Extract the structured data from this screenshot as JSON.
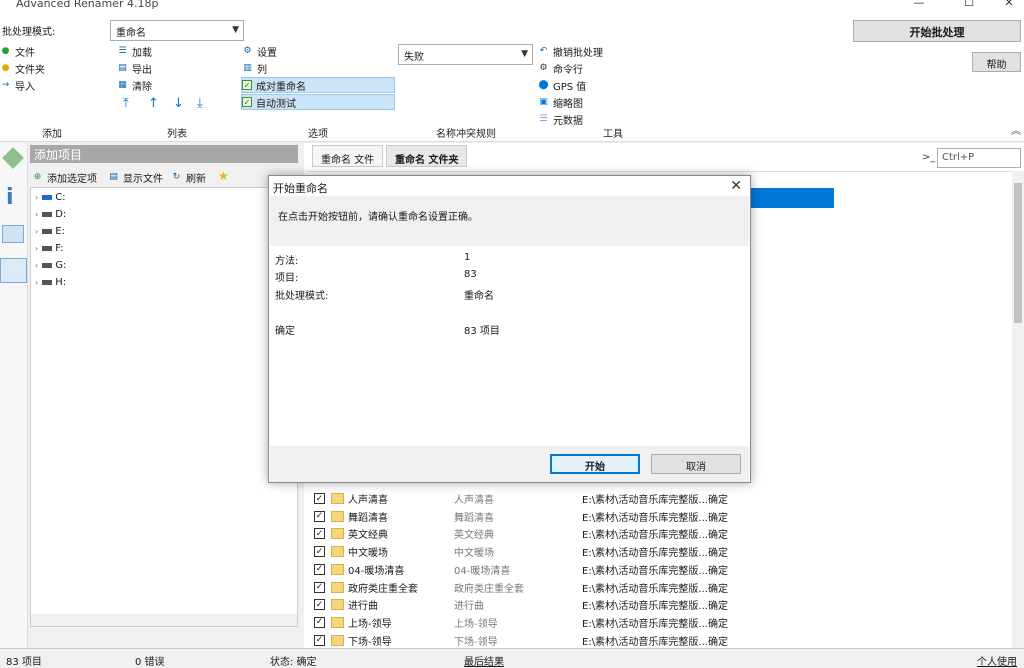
{
  "window": {
    "title": "Advanced Renamer 4.18p",
    "minimize": "—",
    "maximize": "☐",
    "close": "✕"
  },
  "ribbon": {
    "batch_mode_label": "批处理模式:",
    "batch_mode_value": "重命名",
    "add": {
      "file": "文件",
      "folder": "文件夹",
      "import": "导入"
    },
    "list": {
      "load": "加载",
      "export": "导出",
      "clear": "清除"
    },
    "options": {
      "settings": "设置",
      "columns": "列",
      "on_success": "成对重命名",
      "auto_test": "自动测试"
    },
    "conflict_value": "失败",
    "tools": {
      "undo": "撤销批处理",
      "cmd": "命令行",
      "gps": "GPS 值",
      "thumbs": "缩略图",
      "meta": "元数据"
    },
    "start_batch": "开始批处理",
    "help": "帮助",
    "groups": {
      "add": "添加",
      "list": "列表",
      "options": "选项",
      "conflict": "名称冲突规则",
      "tools": "工具"
    }
  },
  "left_panel": {
    "header": "添加项目",
    "toolbar": {
      "add_selected": "添加选定项",
      "show_files": "显示文件",
      "refresh": "刷新"
    },
    "drives": [
      "C:",
      "D:",
      "E:",
      "F:",
      "G:",
      "H:"
    ]
  },
  "right_panel": {
    "tabs": [
      "重命名 文件",
      "重命名 文件夹"
    ],
    "command_placeholder": "Ctrl+P",
    "rows": [
      {
        "name": "人声清喜",
        "new_name": "人声清喜",
        "path": "E:\\素材\\活动音乐库完整版...确定"
      },
      {
        "name": "舞蹈清喜",
        "new_name": "舞蹈清喜",
        "path": "E:\\素材\\活动音乐库完整版...确定"
      },
      {
        "name": "英文经典",
        "new_name": "英文经典",
        "path": "E:\\素材\\活动音乐库完整版...确定"
      },
      {
        "name": "中文暖场",
        "new_name": "中文暖场",
        "path": "E:\\素材\\活动音乐库完整版...确定"
      },
      {
        "name": "04-暖场清喜",
        "new_name": "04-暖场清喜",
        "path": "E:\\素材\\活动音乐库完整版...确定"
      },
      {
        "name": "政府类庄重全套",
        "new_name": "政府类庄重全套",
        "path": "E:\\素材\\活动音乐库完整版...确定"
      },
      {
        "name": "进行曲",
        "new_name": "进行曲",
        "path": "E:\\素材\\活动音乐库完整版...确定"
      },
      {
        "name": "上场-领导",
        "new_name": "上场-领导",
        "path": "E:\\素材\\活动音乐库完整版...确定"
      },
      {
        "name": "下场-领导",
        "new_name": "下场-领导",
        "path": "E:\\素材\\活动音乐库完整版...确定"
      }
    ]
  },
  "status": {
    "items": "83 项目",
    "errors": "0 错误",
    "state": "状态: 确定",
    "last_result": "最后结果",
    "license": "个人使用"
  },
  "dialog": {
    "title": "开始重命名",
    "message": "在点击开始按钮前，请确认重命名设置正确。",
    "method_label": "方法:",
    "method_value": "1",
    "items_label": "项目:",
    "items_value": "83",
    "mode_label": "批处理模式:",
    "mode_value": "重命名",
    "confirm_label": "确定",
    "confirm_value": "83 项目",
    "start": "开始",
    "cancel": "取消"
  }
}
